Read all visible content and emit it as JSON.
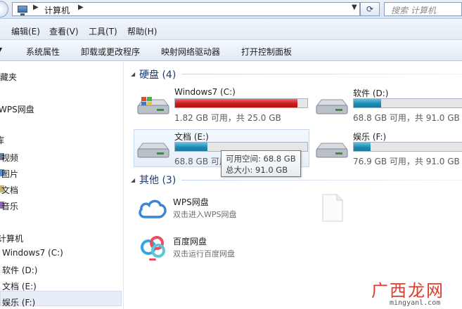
{
  "address_bar": {
    "path": "计算机",
    "refresh_icon": "refresh-icon",
    "search_placeholder": "搜索 计算机"
  },
  "menu": [
    "编辑(E)",
    "查看(V)",
    "工具(T)",
    "帮助(H)"
  ],
  "toolbar": [
    "系统属性",
    "卸载或更改程序",
    "映射网络驱动器",
    "打开控制面板"
  ],
  "sidebar": {
    "favorites": "收藏夹",
    "wps": "WPS网盘",
    "library": "库",
    "library_items": [
      "视频",
      "图片",
      "文档",
      "音乐"
    ],
    "computer": "计算机",
    "computer_items": [
      "Windows7 (C:)",
      "软件 (D:)",
      "文档 (E:)",
      "娱乐 (F:)"
    ]
  },
  "hard_disks": {
    "title": "硬盘 (4)",
    "drives": [
      {
        "name": "Windows7 (C:)",
        "info": "1.82 GB 可用，共 25.0 GB",
        "used_fraction": 0.927,
        "color": "#c81a1a"
      },
      {
        "name": "软件 (D:)",
        "info": "68.8 GB 可用，共 91.0 GB",
        "used_fraction": 0.244,
        "color": "#1f8ab3"
      },
      {
        "name": "文档 (E:)",
        "info": "68.8 GB 可用，共 91.0 GB",
        "used_fraction": 0.244,
        "color": "#1f8ab3"
      },
      {
        "name": "娱乐 (F:)",
        "info": "76.9 GB 可用，共 91.0 GB",
        "used_fraction": 0.155,
        "color": "#1f8ab3"
      }
    ]
  },
  "tooltip": {
    "line1": "可用空间: 68.8 GB",
    "line2": "总大小: 91.0 GB"
  },
  "other": {
    "title": "其他 (3)",
    "items": [
      {
        "title": "WPS网盘",
        "subtitle": "双击进入WPS网盘"
      },
      {
        "title": "百度网盘",
        "subtitle": "双击运行百度网盘"
      }
    ]
  },
  "watermark": {
    "text": "广西龙网",
    "url": "mingyanl.com"
  }
}
